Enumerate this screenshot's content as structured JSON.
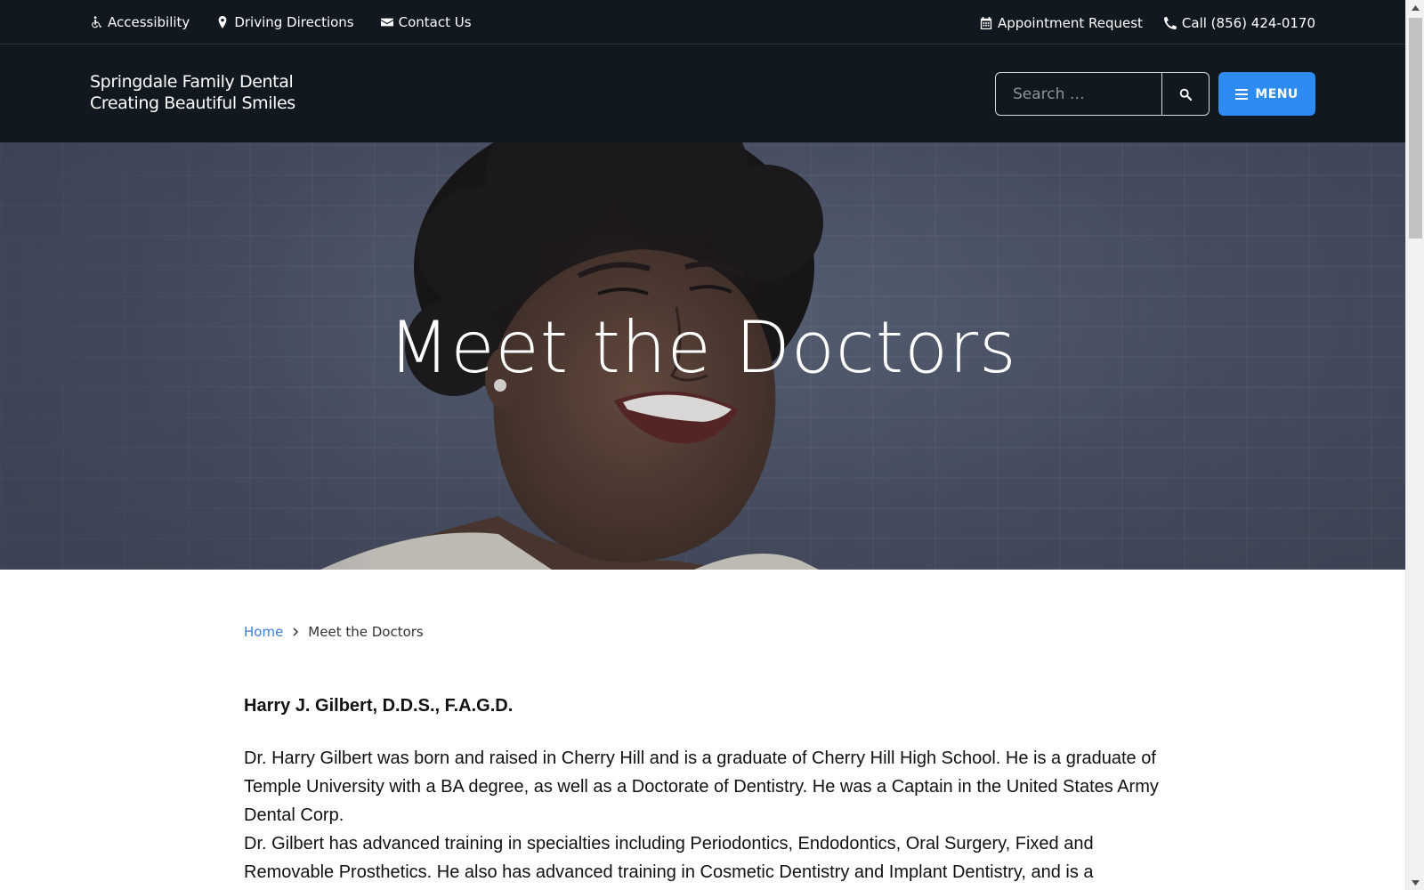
{
  "topbar": {
    "accessibility": "Accessibility",
    "directions": "Driving Directions",
    "contact": "Contact Us",
    "appointment": "Appointment Request",
    "call": "Call (856) 424-0170"
  },
  "header": {
    "brand_line1": "Springdale Family Dental",
    "brand_line2": "Creating Beautiful Smiles",
    "search_placeholder": "Search …",
    "menu_label": "MENU"
  },
  "hero": {
    "title": "Meet the Doctors"
  },
  "breadcrumb": {
    "home": "Home",
    "current": "Meet the Doctors"
  },
  "content": {
    "doctor_name": "Harry J. Gilbert, D.D.S., F.A.G.D.",
    "para1": "Dr. Harry Gilbert was born and raised in Cherry Hill and is a graduate of Cherry Hill High School.  He is a graduate of Temple University with a BA degree, as well as a Doctorate of Dentistry.  He was a Captain in the United States Army Dental Corp.",
    "para2": "Dr. Gilbert has advanced training in specialties including Periodontics, Endodontics, Oral Surgery, Fixed and Removable Prosthetics.  He also has advanced training in Cosmetic Dentistry and Implant Dentistry, and is a"
  },
  "icons": {
    "accessibility": "wheelchair-icon",
    "directions": "map-marker-icon",
    "contact": "envelope-icon",
    "appointment": "calendar-icon",
    "call": "phone-icon",
    "search": "search-icon",
    "menu": "hamburger-icon",
    "breadcrumb": "chevron-right-icon"
  },
  "colors": {
    "header_bg": "#111820",
    "accent": "#2e8bf2",
    "link": "#3b7dd8"
  }
}
